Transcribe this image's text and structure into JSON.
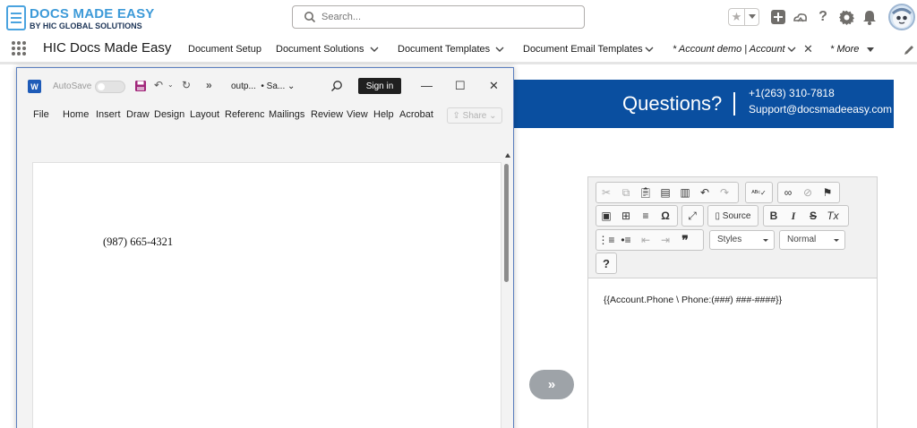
{
  "header": {
    "logo_title": "DOCS MADE EASY",
    "logo_subtitle": "BY HIC GLOBAL SOLUTIONS",
    "search_placeholder": "Search..."
  },
  "nav": {
    "app_name": "HIC Docs Made Easy",
    "items": [
      {
        "label": "Document Setup"
      },
      {
        "label": "Document Solutions"
      },
      {
        "label": "Document Templates"
      },
      {
        "label": "Document Email Templates"
      },
      {
        "label": "* Account demo | Account"
      },
      {
        "label": "* More"
      }
    ]
  },
  "banner": {
    "question": "Questions?",
    "phone": "+1(263) 310-7818",
    "email": "Support@docsmadeeasy.com"
  },
  "arrow_button": {
    "label": "»"
  },
  "editor": {
    "source_label": "Source",
    "styles_label": "Styles",
    "format_label": "Normal",
    "help_label": "?",
    "content": "{{Account.Phone \\ Phone:(###) ###-####}}"
  },
  "word": {
    "autosave_label": "AutoSave",
    "filename": "outp...",
    "save_status": "• Sa...",
    "signin_label": "Sign in",
    "share_label": "Share",
    "menu": [
      "File",
      "Home",
      "Insert",
      "Draw",
      "Design",
      "Layout",
      "Reference",
      "Mailings",
      "Review",
      "View",
      "Help",
      "Acrobat"
    ],
    "document_text": "(987) 665-4321"
  }
}
